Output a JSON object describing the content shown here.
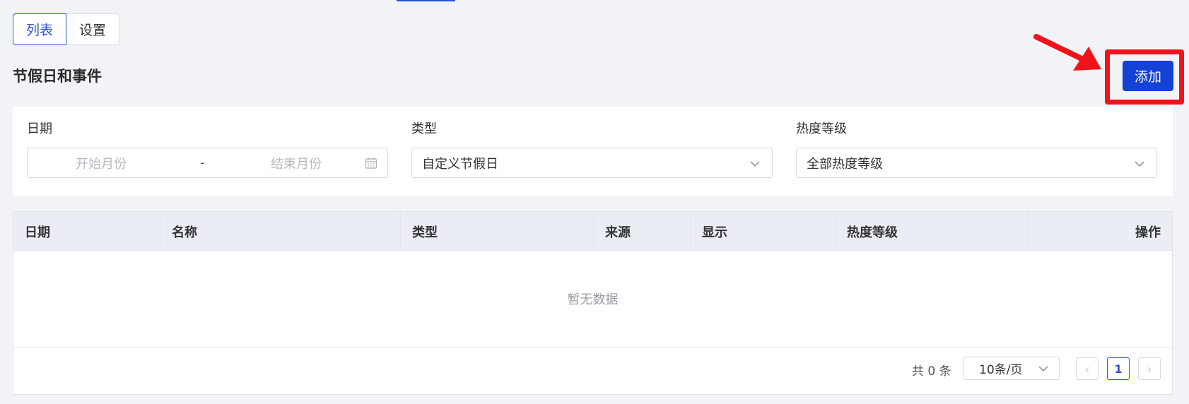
{
  "tabs": [
    {
      "label": "列表",
      "active": true
    },
    {
      "label": "设置",
      "active": false
    }
  ],
  "page_title": "节假日和事件",
  "add_button": {
    "label": "添加"
  },
  "filters": {
    "date": {
      "label": "日期",
      "start_placeholder": "开始月份",
      "separator": "-",
      "end_placeholder": "结束月份"
    },
    "type": {
      "label": "类型",
      "value": "自定义节假日"
    },
    "heat": {
      "label": "热度等级",
      "value": "全部热度等级"
    }
  },
  "table": {
    "columns": [
      "日期",
      "名称",
      "类型",
      "来源",
      "显示",
      "热度等级",
      "操作"
    ],
    "empty_text": "暂无数据"
  },
  "pagination": {
    "total_text": "共 0 条",
    "page_size": "10条/页",
    "prev": "‹",
    "current_page": "1",
    "next": "›"
  },
  "colors": {
    "primary": "#1441d6",
    "annotation": "#f2121c"
  }
}
